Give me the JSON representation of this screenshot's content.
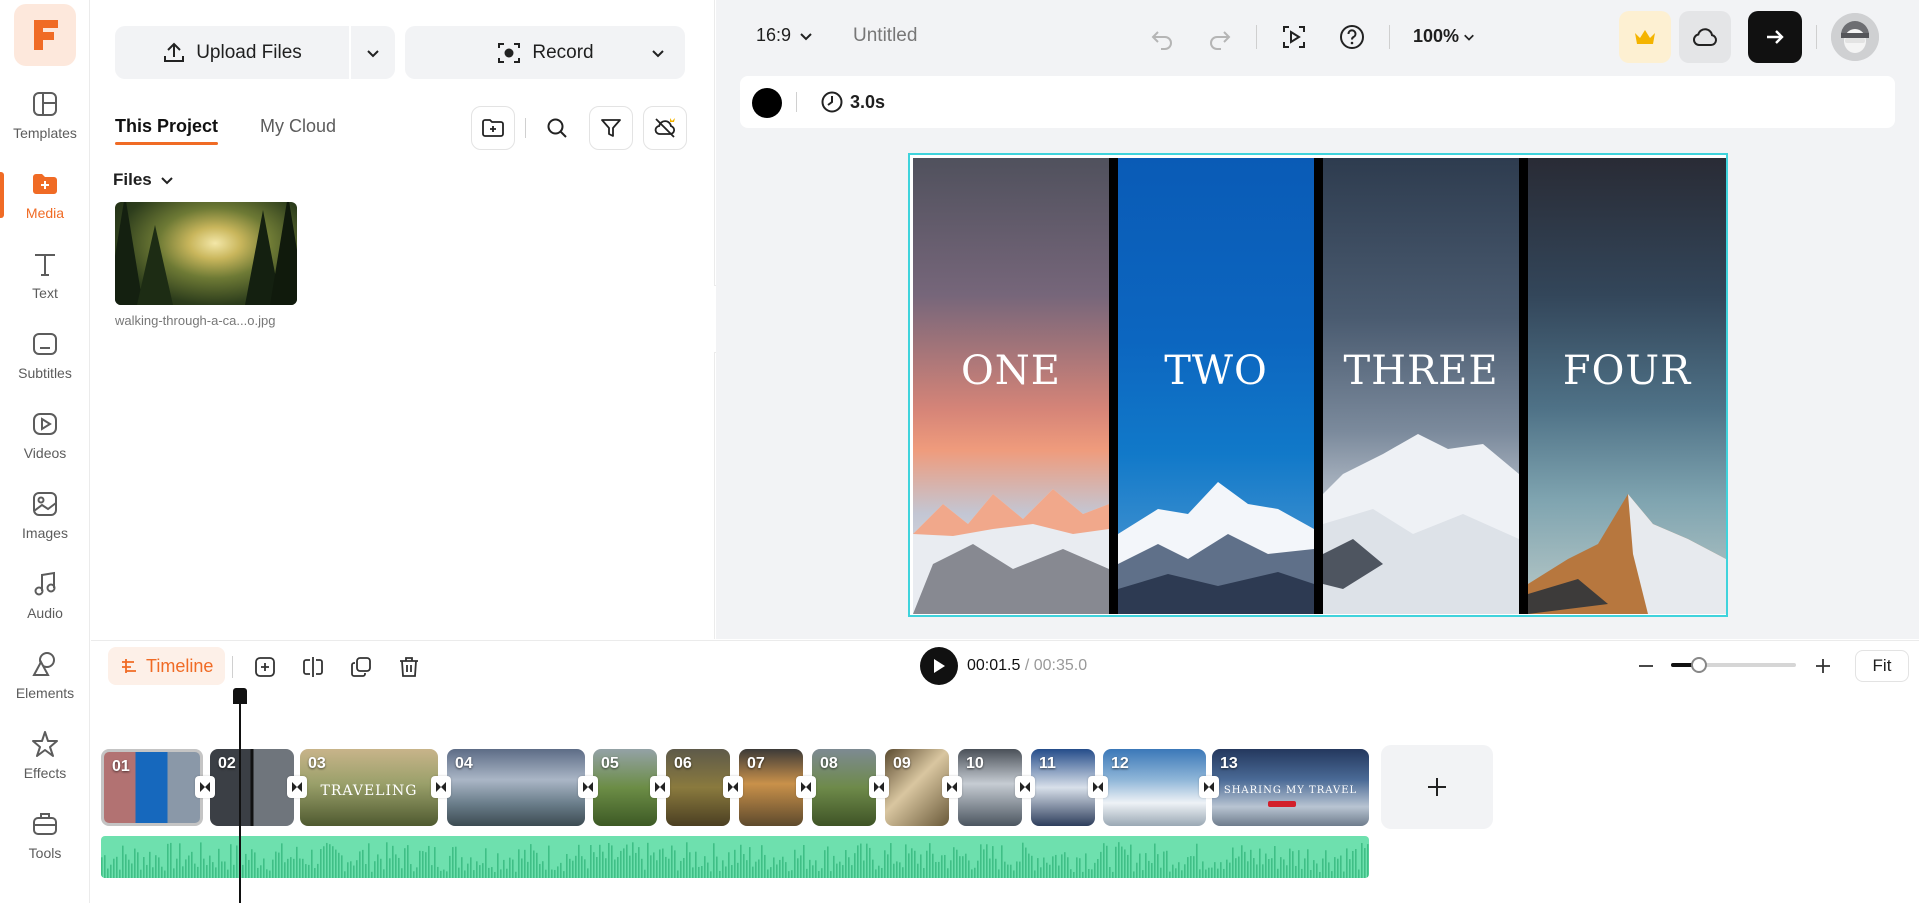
{
  "sidebar": {
    "logo_letter": "F",
    "items": [
      {
        "label": "Templates",
        "icon": "templates-icon"
      },
      {
        "label": "Media",
        "icon": "media-folder-icon",
        "active": true
      },
      {
        "label": "Text",
        "icon": "text-icon"
      },
      {
        "label": "Subtitles",
        "icon": "subtitles-icon"
      },
      {
        "label": "Videos",
        "icon": "videos-icon"
      },
      {
        "label": "Images",
        "icon": "images-icon"
      },
      {
        "label": "Audio",
        "icon": "audio-note-icon"
      },
      {
        "label": "Elements",
        "icon": "elements-shapes-icon"
      },
      {
        "label": "Effects",
        "icon": "effects-star-icon"
      },
      {
        "label": "Tools",
        "icon": "tools-briefcase-icon"
      }
    ]
  },
  "media_panel": {
    "upload_label": "Upload Files",
    "record_label": "Record",
    "tabs": [
      "This Project",
      "My Cloud"
    ],
    "files_label": "Files",
    "file_name": "walking-through-a-ca...o.jpg"
  },
  "topbar": {
    "aspect_ratio": "16:9",
    "project_title": "Untitled",
    "zoom": "100%"
  },
  "properties": {
    "duration": "3.0s",
    "color": "#000000"
  },
  "canvas": {
    "panels": [
      "ONE",
      "TWO",
      "THREE",
      "FOUR"
    ]
  },
  "timeline": {
    "tab_label": "Timeline",
    "current_time": "00:01.5",
    "total_time": "/ 00:35.0",
    "fit_label": "Fit",
    "zoom_level_fraction": 0.22,
    "clips": [
      {
        "num": "01",
        "overlay": ""
      },
      {
        "num": "02",
        "overlay": ""
      },
      {
        "num": "03",
        "overlay": "TRAVELING"
      },
      {
        "num": "04",
        "overlay": ""
      },
      {
        "num": "05",
        "overlay": ""
      },
      {
        "num": "06",
        "overlay": ""
      },
      {
        "num": "07",
        "overlay": ""
      },
      {
        "num": "08",
        "overlay": ""
      },
      {
        "num": "09",
        "overlay": ""
      },
      {
        "num": "10",
        "overlay": ""
      },
      {
        "num": "11",
        "overlay": ""
      },
      {
        "num": "12",
        "overlay": ""
      },
      {
        "num": "13",
        "overlay": "SHARING MY TRAVEL"
      }
    ]
  },
  "colors": {
    "accent": "#f06b25",
    "selection": "#3fd3dc",
    "audio_track": "#6ee0ae"
  }
}
